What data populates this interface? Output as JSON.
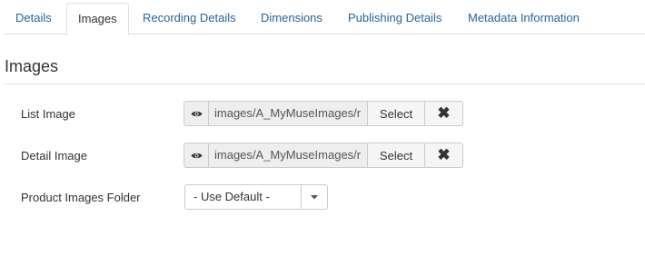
{
  "tabs": [
    {
      "label": "Details"
    },
    {
      "label": "Images"
    },
    {
      "label": "Recording Details"
    },
    {
      "label": "Dimensions"
    },
    {
      "label": "Publishing Details"
    },
    {
      "label": "Metadata Information"
    }
  ],
  "active_tab": "Images",
  "section": {
    "title": "Images"
  },
  "fields": {
    "list_image": {
      "label": "List Image",
      "value": "images/A_MyMuseImages/r",
      "select_label": "Select",
      "clear_label": "✖"
    },
    "detail_image": {
      "label": "Detail Image",
      "value": "images/A_MyMuseImages/r",
      "select_label": "Select",
      "clear_label": "✖"
    },
    "product_images_folder": {
      "label": "Product Images Folder",
      "selected": "- Use Default -"
    }
  },
  "icons": {
    "preview": "eye-icon",
    "clear": "x-icon",
    "dropdown": "caret-down-icon"
  },
  "colors": {
    "link": "#2a6496",
    "text": "#333333",
    "border": "#dddddd"
  }
}
